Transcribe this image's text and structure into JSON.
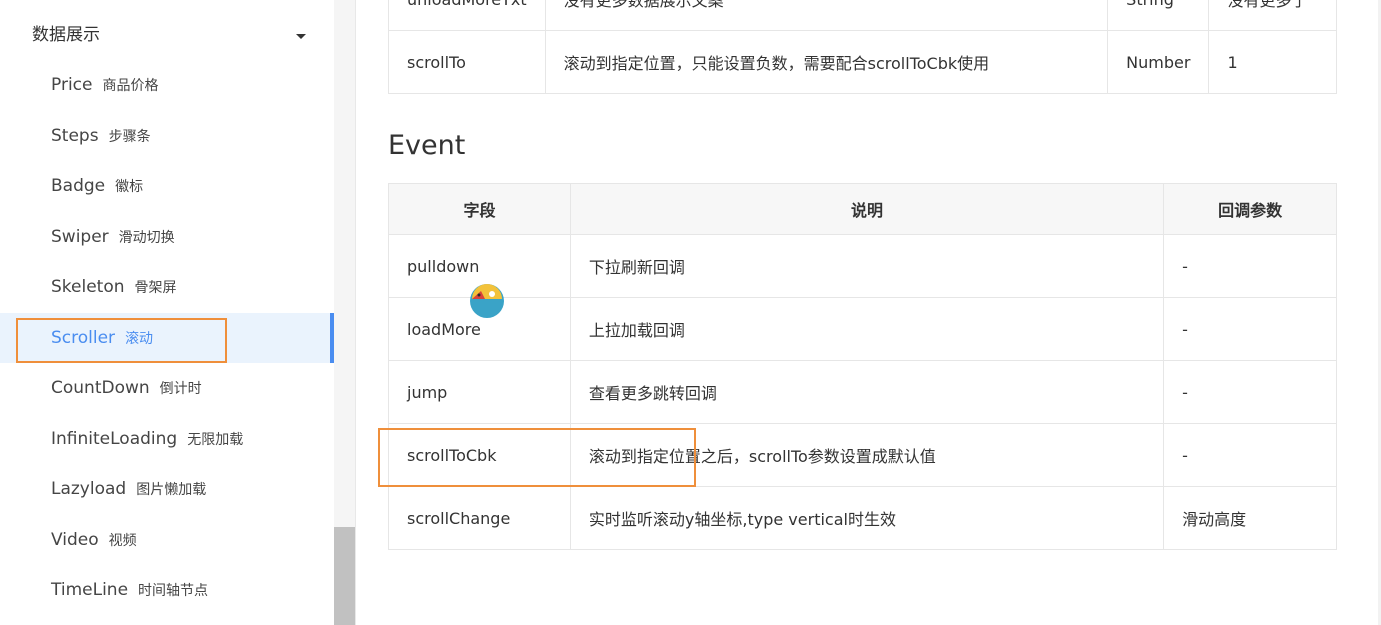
{
  "sidebar": {
    "group_title": "数据展示",
    "items": [
      {
        "en": "Price",
        "cn": "商品价格"
      },
      {
        "en": "Steps",
        "cn": "步骤条"
      },
      {
        "en": "Badge",
        "cn": "徽标"
      },
      {
        "en": "Swiper",
        "cn": "滑动切换"
      },
      {
        "en": "Skeleton",
        "cn": "骨架屏"
      },
      {
        "en": "Scroller",
        "cn": "滚动"
      },
      {
        "en": "CountDown",
        "cn": "倒计时"
      },
      {
        "en": "InfiniteLoading",
        "cn": "无限加载"
      },
      {
        "en": "Lazyload",
        "cn": "图片懒加载"
      },
      {
        "en": "Video",
        "cn": "视频"
      },
      {
        "en": "TimeLine",
        "cn": "时间轴节点"
      }
    ],
    "active_index": 5
  },
  "props_table": {
    "rows": [
      {
        "field": "unloadMoreTxt",
        "desc": "没有更多数据展示文案",
        "type": "String",
        "default": "没有更多了"
      },
      {
        "field": "scrollTo",
        "desc": "滚动到指定位置，只能设置负数，需要配合scrollToCbk使用",
        "type": "Number",
        "default": "1"
      }
    ]
  },
  "event_section": {
    "title": "Event",
    "headers": [
      "字段",
      "说明",
      "回调参数"
    ],
    "rows": [
      {
        "field": "pulldown",
        "desc": "下拉刷新回调",
        "param": "-"
      },
      {
        "field": "loadMore",
        "desc": "上拉加载回调",
        "param": "-"
      },
      {
        "field": "jump",
        "desc": "查看更多跳转回调",
        "param": "-"
      },
      {
        "field": "scrollToCbk",
        "desc": "滚动到指定位置之后，scrollTo参数设置成默认值",
        "param": "-"
      },
      {
        "field": "scrollChange",
        "desc": "实时监听滚动y轴坐标,type vertical时生效",
        "param": "滑动高度"
      }
    ]
  },
  "colors": {
    "accent": "#4a8df0",
    "highlight_box": "#ef8f3b"
  }
}
